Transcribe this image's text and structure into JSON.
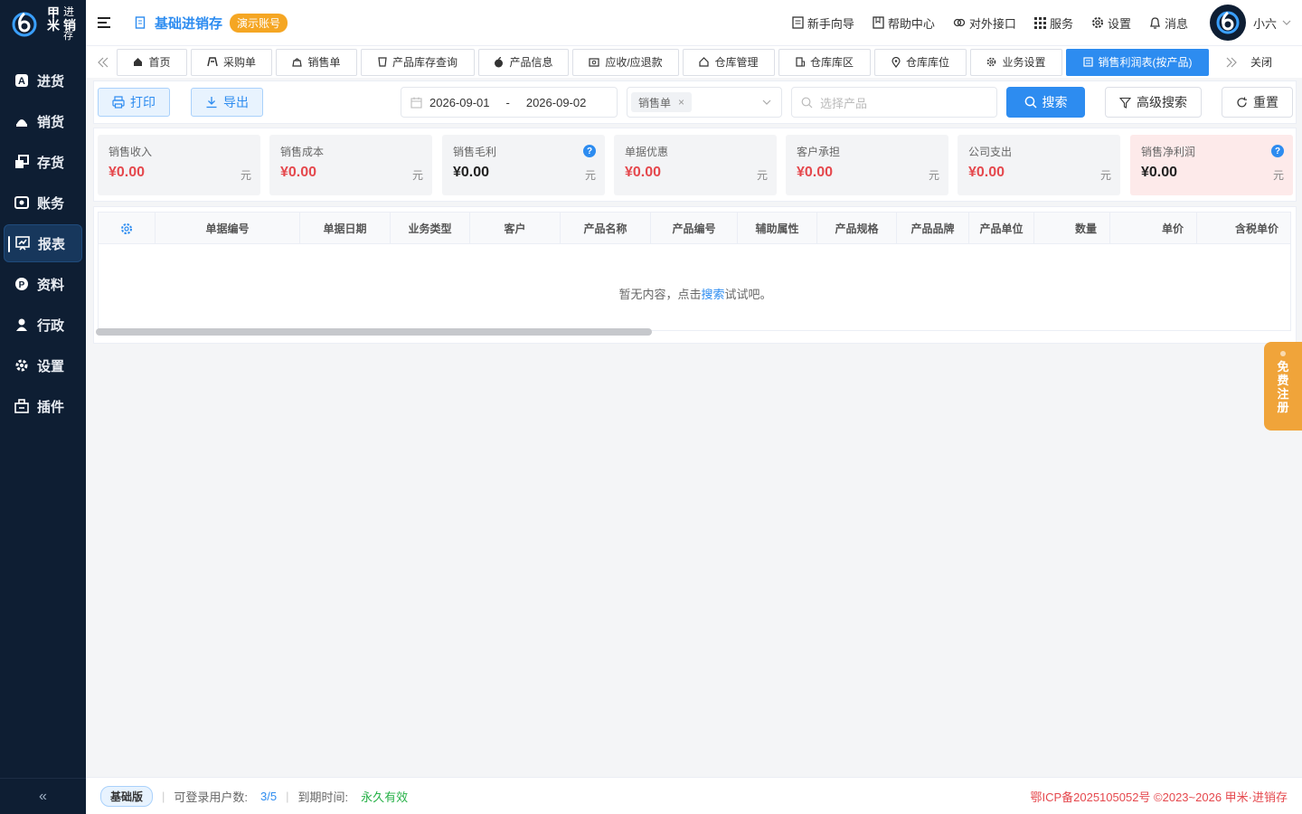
{
  "app": {
    "logo_chars": [
      "甲",
      "米"
    ],
    "logo_chars_small": [
      "进",
      "销",
      "存"
    ],
    "title": "基础进销存",
    "demo_badge": "演示账号"
  },
  "sidebar": {
    "items": [
      {
        "label": "进货",
        "icon": "purchase-icon"
      },
      {
        "label": "销货",
        "icon": "sales-icon"
      },
      {
        "label": "存货",
        "icon": "inventory-icon"
      },
      {
        "label": "账务",
        "icon": "finance-icon"
      },
      {
        "label": "报表",
        "icon": "report-icon",
        "active": true
      },
      {
        "label": "资料",
        "icon": "data-icon"
      },
      {
        "label": "行政",
        "icon": "admin-icon"
      },
      {
        "label": "设置",
        "icon": "settings-icon"
      },
      {
        "label": "插件",
        "icon": "plugin-icon"
      }
    ],
    "collapse_glyph": "«"
  },
  "header": {
    "links": [
      {
        "label": "新手向导",
        "icon": "guide-icon"
      },
      {
        "label": "帮助中心",
        "icon": "help-icon"
      },
      {
        "label": "对外接口",
        "icon": "api-icon"
      },
      {
        "label": "服务",
        "icon": "grid-icon"
      },
      {
        "label": "设置",
        "icon": "gear-icon"
      },
      {
        "label": "消息",
        "icon": "bell-icon"
      }
    ],
    "username": "小六"
  },
  "tabs": {
    "items": [
      {
        "label": "首页",
        "icon": "home-icon"
      },
      {
        "label": "采购单",
        "icon": "truck-icon"
      },
      {
        "label": "销售单",
        "icon": "bag-icon"
      },
      {
        "label": "产品库存查询",
        "icon": "cup-icon"
      },
      {
        "label": "产品信息",
        "icon": "apple-icon"
      },
      {
        "label": "应收/应退款",
        "icon": "money-icon"
      },
      {
        "label": "仓库管理",
        "icon": "house-icon"
      },
      {
        "label": "仓库库区",
        "icon": "building-icon"
      },
      {
        "label": "仓库库位",
        "icon": "location-icon"
      },
      {
        "label": "业务设置",
        "icon": "gear-icon"
      },
      {
        "label": "销售利润表(按产品)",
        "icon": "report-icon",
        "active": true
      }
    ],
    "close_label": "关闭"
  },
  "toolbar": {
    "print_label": "打印",
    "export_label": "导出",
    "date_start": "2026-09-01",
    "date_sep": "-",
    "date_end": "2026-09-02",
    "type_chip": "销售单",
    "product_placeholder": "选择产品",
    "search_label": "搜索",
    "advanced_label": "高级搜索",
    "reset_label": "重置"
  },
  "stats": [
    {
      "label": "销售收入",
      "value": "¥0.00",
      "unit": "元",
      "style": "red"
    },
    {
      "label": "销售成本",
      "value": "¥0.00",
      "unit": "元",
      "style": "red"
    },
    {
      "label": "销售毛利",
      "value": "¥0.00",
      "unit": "元",
      "style": "dark",
      "help": "?"
    },
    {
      "label": "单据优惠",
      "value": "¥0.00",
      "unit": "元",
      "style": "red"
    },
    {
      "label": "客户承担",
      "value": "¥0.00",
      "unit": "元",
      "style": "red"
    },
    {
      "label": "公司支出",
      "value": "¥0.00",
      "unit": "元",
      "style": "red"
    },
    {
      "label": "销售净利润",
      "value": "¥0.00",
      "unit": "元",
      "style": "dark",
      "help": "?"
    }
  ],
  "table": {
    "columns": [
      "单据编号",
      "单据日期",
      "业务类型",
      "客户",
      "产品名称",
      "产品编号",
      "辅助属性",
      "产品规格",
      "产品品牌",
      "产品单位",
      "数量",
      "单价",
      "含税单价"
    ],
    "empty_prefix": "暂无内容，点击",
    "empty_link": "搜索",
    "empty_suffix": "试试吧。"
  },
  "float_register": [
    "免",
    "费",
    "注",
    "册"
  ],
  "footer": {
    "edition": "基础版",
    "users_label": "可登录用户数:",
    "users_value": "3/5",
    "expire_label": "到期时间:",
    "expire_value": "永久有效",
    "icp": "鄂ICP备2025105052号 ©2023~2026 甲米·进销存"
  },
  "colors": {
    "sidebar_bg": "#0e1e33",
    "primary": "#2d8cf0",
    "accent_orange": "#f5a623",
    "red": "#e5484d",
    "green": "#27b148"
  }
}
